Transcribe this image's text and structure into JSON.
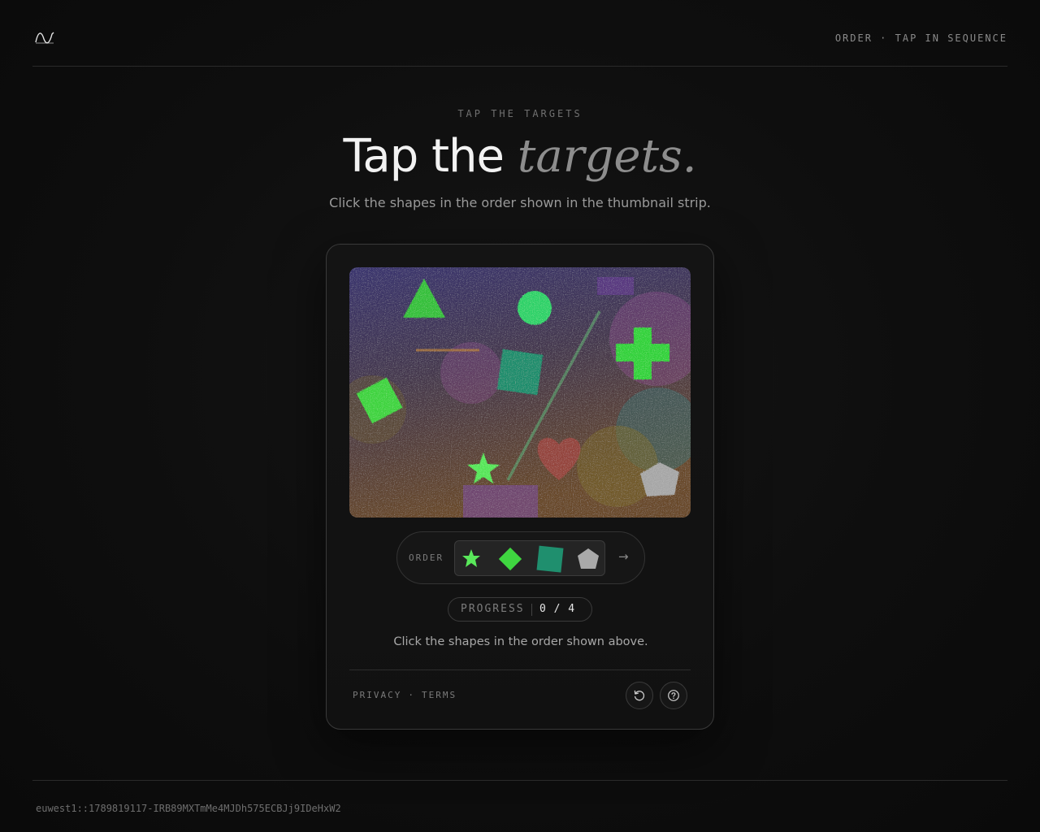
{
  "header": {
    "logo_icon": "wave-logo-icon",
    "nav_text": "ORDER · TAP IN SEQUENCE"
  },
  "hero": {
    "eyebrow": "TAP THE TARGETS",
    "title_main": "Tap the",
    "title_accent": "targets.",
    "subtitle": "Click the shapes in the order shown in the thumbnail strip."
  },
  "challenge": {
    "canvas_shapes": [
      {
        "kind": "triangle",
        "color": "#34c23a"
      },
      {
        "kind": "circle",
        "color": "#2fd46a"
      },
      {
        "kind": "cross",
        "color": "#33d43a"
      },
      {
        "kind": "square",
        "color": "#1f8f6e"
      },
      {
        "kind": "diamond",
        "color": "#3fd640"
      },
      {
        "kind": "star",
        "color": "#59e85a"
      },
      {
        "kind": "heart",
        "color": "#a0463e"
      },
      {
        "kind": "pentagon",
        "color": "#a9a9a9"
      }
    ],
    "order": {
      "label": "ORDER",
      "thumbnails": [
        {
          "icon": "star-icon",
          "color": "#59e85a"
        },
        {
          "icon": "diamond-icon",
          "color": "#3fd640"
        },
        {
          "icon": "square-icon",
          "color": "#1f8f6e"
        },
        {
          "icon": "pentagon-icon",
          "color": "#a9a9a9"
        }
      ],
      "arrow": "→"
    },
    "progress": {
      "label": "PROGRESS",
      "current": 0,
      "total": 4,
      "value_text": "0 / 4"
    },
    "instruction": "Click the shapes in the order shown above."
  },
  "footer_card": {
    "privacy": "PRIVACY",
    "separator": "·",
    "terms": "TERMS",
    "refresh_icon": "refresh-icon",
    "help_icon": "help-icon"
  },
  "trace_id": "euwest1::1789819117-IRB89MXTmMe4MJDh575ECBJj9IDeHxW2",
  "colors": {
    "background": "#0e0e0e",
    "card_border": "#3a3a3a",
    "accent_text": "#8d8d8d"
  }
}
